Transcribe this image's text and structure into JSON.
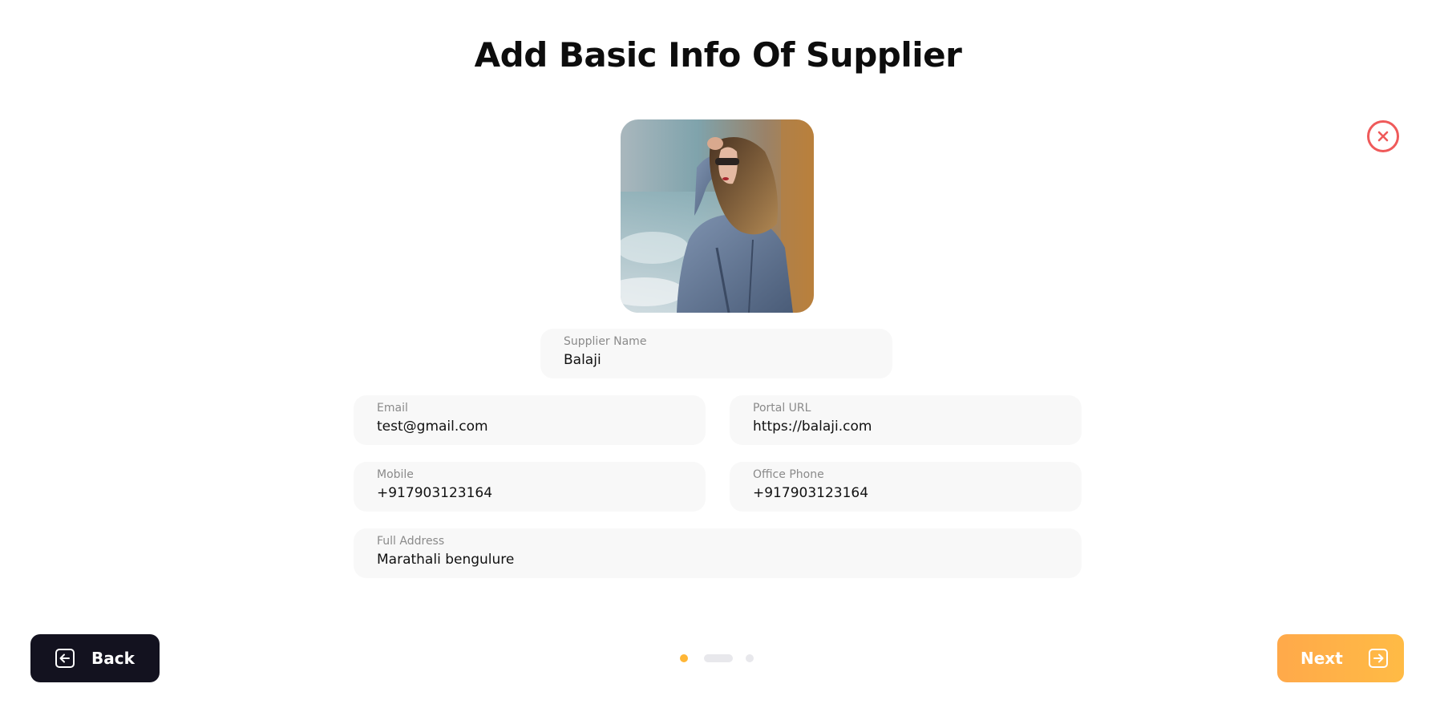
{
  "header": {
    "title": "Add Basic Info Of Supplier"
  },
  "form": {
    "supplier_name": {
      "label": "Supplier Name",
      "value": "Balaji"
    },
    "email": {
      "label": "Email",
      "value": "test@gmail.com"
    },
    "portal_url": {
      "label": "Portal URL",
      "value": "https://balaji.com"
    },
    "mobile": {
      "label": "Mobile",
      "value": "+917903123164"
    },
    "office_phone": {
      "label": "Office Phone",
      "value": "+917903123164"
    },
    "full_address": {
      "label": "Full Address",
      "value": "Marathali bengulure"
    }
  },
  "footer": {
    "back_label": "Back",
    "next_label": "Next",
    "steps": {
      "total": 3,
      "current": 1
    }
  },
  "icons": {
    "close": "close-icon",
    "back": "arrow-left-box-icon",
    "next": "arrow-right-box-icon"
  },
  "colors": {
    "accent": "#ffb636",
    "close": "#ef5a5a",
    "back_button": "#13121f",
    "field_bg": "#f8f8f8"
  }
}
